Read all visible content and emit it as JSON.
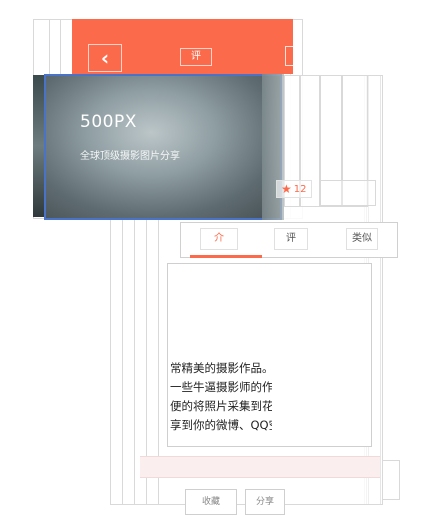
{
  "header": {
    "back_glyph": "‹",
    "title": "评"
  },
  "hero": {
    "title": "500PX",
    "subtitle": "全球顶级摄影图片分享"
  },
  "stats": {
    "star_icon": "star-icon",
    "count": "12"
  },
  "tabs": [
    {
      "label": "介"
    },
    {
      "label": "评"
    },
    {
      "label": "类似"
    }
  ],
  "description": {
    "lines": [
      "常精美的摄影作品。在",
      "一些牛逼摄影师的作品",
      "便的将照片采集到花瓣",
      "享到你的微博、QQ空间"
    ]
  },
  "footer": {
    "left_label": "收藏",
    "right_label": "分享"
  },
  "colors": {
    "accent": "#fb6a4b",
    "frame_blue": "#4a73c8"
  }
}
